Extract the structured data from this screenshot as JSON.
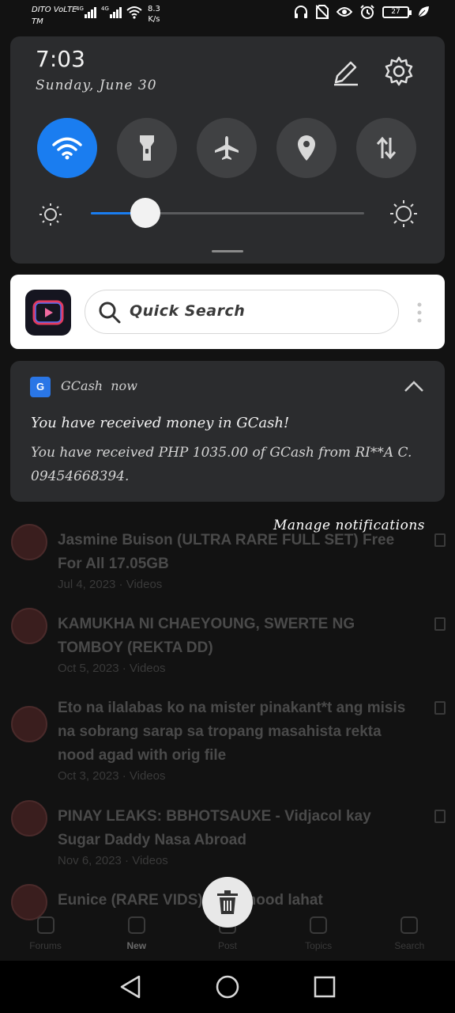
{
  "status_bar": {
    "carrier_top": "DITO VoLTE",
    "carrier_bottom": "TM",
    "network_1": "4G",
    "network_2": "4G",
    "speed_value": "8.3",
    "speed_unit": "K/s",
    "battery": "27"
  },
  "quick_settings": {
    "time": "7:03",
    "date": "Sunday, June 30",
    "toggles": [
      {
        "name": "wifi",
        "icon": "wifi-icon",
        "on": true
      },
      {
        "name": "flashlight",
        "icon": "flashlight-icon",
        "on": false
      },
      {
        "name": "airplane-mode",
        "icon": "airplane-icon",
        "on": false
      },
      {
        "name": "location",
        "icon": "location-icon",
        "on": false
      },
      {
        "name": "mobile-data",
        "icon": "data-arrows-icon",
        "on": false
      }
    ],
    "brightness_level": 0.2,
    "accent_color": "#1a7df0"
  },
  "quick_search": {
    "placeholder": "Quick Search"
  },
  "notification": {
    "app_name": "GCash",
    "time": "now",
    "icon_letter": "G",
    "title": "You have received money in GCash!",
    "body": "You have received PHP 1035.00 of GCash from RI**A C. 09454668394."
  },
  "manage_notifications": "Manage notifications",
  "background_feed": {
    "items": [
      {
        "title": "Jasmine Buison (ULTRA RARE FULL SET) Free For All 17.05GB",
        "meta": "Jul 4, 2023 · Videos"
      },
      {
        "title": "KAMUKHA NI CHAEYOUNG, SWERTE NG TOMBOY (REKTA DD)",
        "meta": "Oct 5, 2023 · Videos"
      },
      {
        "title": "Eto na ilalabas ko na mister pinakant*t ang misis na sobrang sarap sa tropang masahista rekta nood agad with orig file",
        "meta": "Oct 3, 2023 · Videos"
      },
      {
        "title": "PINAY LEAKS: BBHOTSAUXE - Vidjacol kay Sugar Daddy Nasa Abroad",
        "meta": "Nov 6, 2023 · Videos"
      },
      {
        "title": "Eunice (RARE VIDS) rekta nood lahat",
        "meta": ""
      }
    ],
    "tabs": [
      {
        "label": "Forums",
        "active": false
      },
      {
        "label": "New",
        "active": true
      },
      {
        "label": "Post",
        "active": false
      },
      {
        "label": "Topics",
        "active": false
      },
      {
        "label": "Search",
        "active": false
      }
    ]
  }
}
